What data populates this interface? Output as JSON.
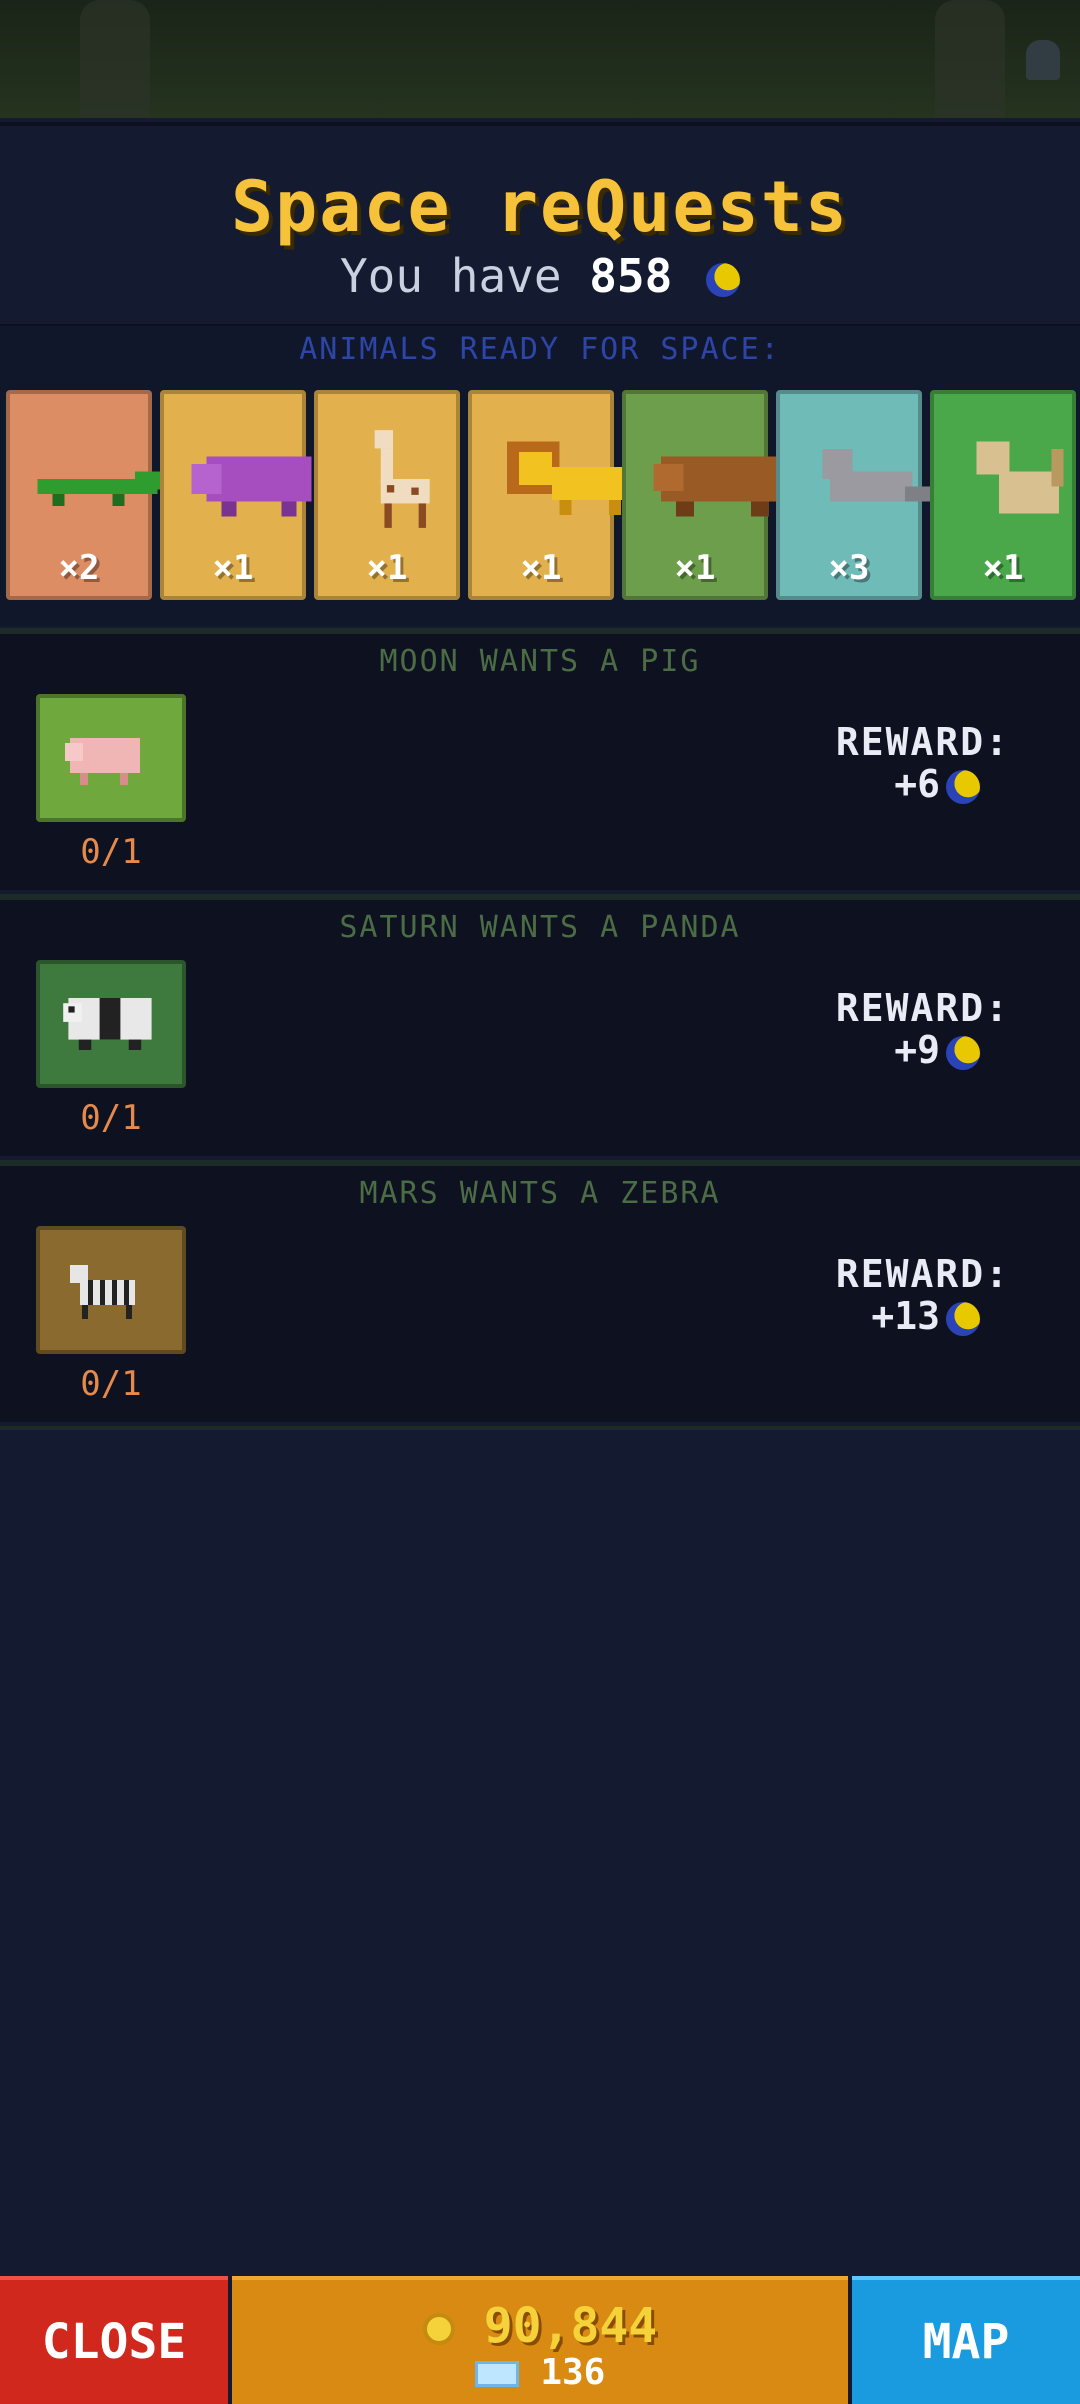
{
  "header": {
    "title": "Space reQuests",
    "you_have_prefix": "You have",
    "balance": "858"
  },
  "ready": {
    "label": "ANIMALS READY FOR SPACE:",
    "cards": [
      {
        "animal": "crocodile",
        "count": "×2",
        "bg": "#dd8d63"
      },
      {
        "animal": "hippo",
        "count": "×1",
        "bg": "#e2b14d"
      },
      {
        "animal": "giraffe",
        "count": "×1",
        "bg": "#e2b14d"
      },
      {
        "animal": "lion",
        "count": "×1",
        "bg": "#e2b14d"
      },
      {
        "animal": "bear",
        "count": "×1",
        "bg": "#6c9e4b"
      },
      {
        "animal": "seal",
        "count": "×3",
        "bg": "#6fbbb8"
      },
      {
        "animal": "monkey",
        "count": "×1",
        "bg": "#4aa84a"
      }
    ]
  },
  "requests": [
    {
      "title": "MOON WANTS A PIG",
      "progress": "0/1",
      "reward_label": "REWARD:",
      "reward": "+6",
      "box_bg": "#6fa83c",
      "animal": "pig"
    },
    {
      "title": "SATURN WANTS A PANDA",
      "progress": "0/1",
      "reward_label": "REWARD:",
      "reward": "+9",
      "box_bg": "#3e7a3e",
      "animal": "panda"
    },
    {
      "title": "MARS WANTS A ZEBRA",
      "progress": "0/1",
      "reward_label": "REWARD:",
      "reward": "+13",
      "box_bg": "#8a6a2e",
      "animal": "zebra"
    }
  ],
  "bottom": {
    "close": "CLOSE",
    "coins": "90,844",
    "gems": "136",
    "map": "MAP"
  }
}
